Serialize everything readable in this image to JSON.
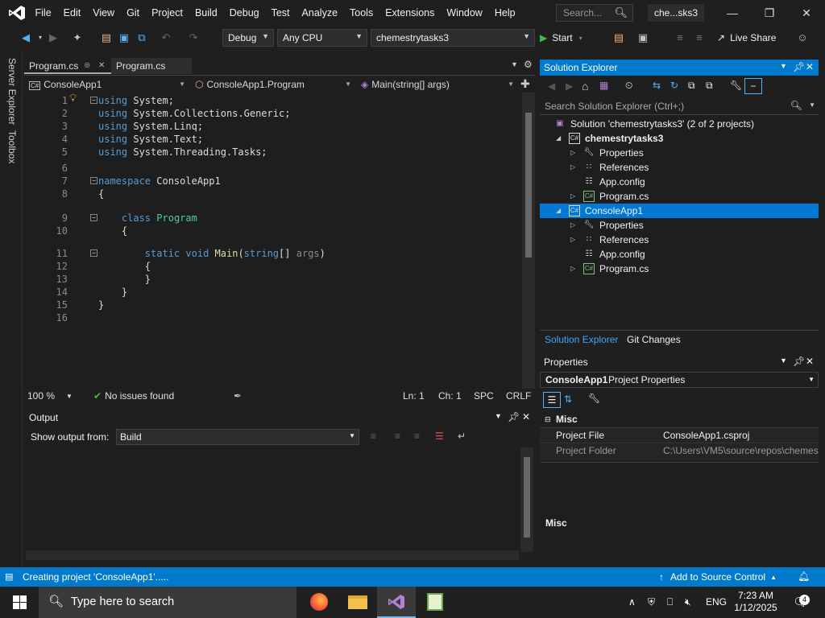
{
  "menubar": {
    "items": [
      "File",
      "Edit",
      "View",
      "Git",
      "Project",
      "Build",
      "Debug",
      "Test",
      "Analyze",
      "Tools",
      "Extensions",
      "Window",
      "Help"
    ],
    "search_placeholder": "Search...",
    "solution_title": "che...sks3"
  },
  "toolbar": {
    "config": "Debug",
    "platform": "Any CPU",
    "startup_project": "chemestrytasks3",
    "start_label": "Start",
    "live_share": "Live Share"
  },
  "left_strip": {
    "server_explorer": "Server Explorer",
    "toolbox": "Toolbox"
  },
  "editor": {
    "tabs": [
      "Program.cs",
      "Program.cs"
    ],
    "nav": {
      "project": "ConsoleApp1",
      "class": "ConsoleApp1.Program",
      "member": "Main(string[] args)"
    },
    "lines": [
      {
        "n": "1",
        "parts": [
          [
            "kw",
            "using"
          ],
          [
            "tx",
            " System;"
          ]
        ]
      },
      {
        "n": "2",
        "parts": [
          [
            "kw",
            "using"
          ],
          [
            "tx",
            " System.Collections.Generic;"
          ]
        ]
      },
      {
        "n": "3",
        "parts": [
          [
            "kw",
            "using"
          ],
          [
            "tx",
            " System.Linq;"
          ]
        ]
      },
      {
        "n": "4",
        "parts": [
          [
            "kw",
            "using"
          ],
          [
            "tx",
            " System.Text;"
          ]
        ]
      },
      {
        "n": "5",
        "parts": [
          [
            "kw",
            "using"
          ],
          [
            "tx",
            " System.Threading.Tasks;"
          ]
        ]
      },
      {
        "n": "6",
        "parts": []
      },
      {
        "n": "7",
        "parts": [
          [
            "kw",
            "namespace"
          ],
          [
            "tx",
            " ConsoleApp1"
          ]
        ]
      },
      {
        "n": "8",
        "parts": [
          [
            "tx",
            "{"
          ]
        ]
      },
      {
        "n": "9",
        "parts": [
          [
            "tx",
            "    "
          ],
          [
            "kw",
            "class"
          ],
          [
            "tx",
            " "
          ],
          [
            "ty",
            "Program"
          ]
        ]
      },
      {
        "n": "10",
        "parts": [
          [
            "tx",
            "    {"
          ]
        ]
      },
      {
        "n": "11",
        "parts": [
          [
            "tx",
            "        "
          ],
          [
            "kw",
            "static"
          ],
          [
            "tx",
            " "
          ],
          [
            "kw",
            "void"
          ],
          [
            "tx",
            " "
          ],
          [
            "fn",
            "Main"
          ],
          [
            "tx",
            "("
          ],
          [
            "kw",
            "string"
          ],
          [
            "tx",
            "[] "
          ],
          [
            "dim",
            "args"
          ],
          [
            "tx",
            ")"
          ]
        ]
      },
      {
        "n": "12",
        "parts": [
          [
            "tx",
            "        {"
          ]
        ]
      },
      {
        "n": "13",
        "parts": [
          [
            "tx",
            "        }"
          ]
        ]
      },
      {
        "n": "14",
        "parts": [
          [
            "tx",
            "    }"
          ]
        ]
      },
      {
        "n": "15",
        "parts": [
          [
            "tx",
            "}"
          ]
        ]
      },
      {
        "n": "16",
        "parts": []
      }
    ],
    "status": {
      "zoom": "100 %",
      "issues": "No issues found",
      "ln": "Ln: 1",
      "ch": "Ch: 1",
      "spc": "SPC",
      "crlf": "CRLF"
    }
  },
  "output": {
    "title": "Output",
    "show_from_label": "Show output from:",
    "source": "Build"
  },
  "solution_explorer": {
    "title": "Solution Explorer",
    "search_placeholder": "Search Solution Explorer (Ctrl+;)",
    "tree": [
      {
        "depth": 0,
        "label": "Solution 'chemestrytasks3' (2 of 2 projects)",
        "icon": "solution-icon",
        "chev": "",
        "bold": false,
        "selected": false
      },
      {
        "depth": 1,
        "label": "chemestrytasks3",
        "icon": "csharp-project-icon",
        "chev": "expanded",
        "bold": true,
        "selected": false
      },
      {
        "depth": 2,
        "label": "Properties",
        "icon": "wrench-icon",
        "chev": "collapsed",
        "bold": false,
        "selected": false
      },
      {
        "depth": 2,
        "label": "References",
        "icon": "references-icon",
        "chev": "collapsed",
        "bold": false,
        "selected": false
      },
      {
        "depth": 2,
        "label": "App.config",
        "icon": "config-file-icon",
        "chev": "",
        "bold": false,
        "selected": false
      },
      {
        "depth": 2,
        "label": "Program.cs",
        "icon": "csharp-file-icon",
        "chev": "collapsed",
        "bold": false,
        "selected": false
      },
      {
        "depth": 1,
        "label": "ConsoleApp1",
        "icon": "csharp-project-icon",
        "chev": "expanded",
        "bold": false,
        "selected": true
      },
      {
        "depth": 2,
        "label": "Properties",
        "icon": "wrench-icon",
        "chev": "collapsed",
        "bold": false,
        "selected": false
      },
      {
        "depth": 2,
        "label": "References",
        "icon": "references-icon",
        "chev": "collapsed",
        "bold": false,
        "selected": false
      },
      {
        "depth": 2,
        "label": "App.config",
        "icon": "config-file-icon",
        "chev": "",
        "bold": false,
        "selected": false
      },
      {
        "depth": 2,
        "label": "Program.cs",
        "icon": "csharp-file-icon",
        "chev": "collapsed",
        "bold": false,
        "selected": false
      }
    ],
    "tabs": [
      "Solution Explorer",
      "Git Changes"
    ]
  },
  "properties": {
    "title": "Properties",
    "object_name": "ConsoleApp1",
    "object_type": "Project Properties",
    "category": "Misc",
    "rows": [
      {
        "name": "Project File",
        "value": "ConsoleApp1.csproj"
      },
      {
        "name": "Project Folder",
        "value": "C:\\Users\\VM5\\source\\repos\\chemes"
      }
    ],
    "desc_title": "Misc"
  },
  "statusbar": {
    "message": "Creating project 'ConsoleApp1'.....",
    "source_control": "Add to Source Control",
    "notifications": "1"
  },
  "taskbar": {
    "search_placeholder": "Type here to search",
    "lang": "ENG",
    "time": "7:23 AM",
    "date": "1/12/2025",
    "notif_count": "4"
  },
  "colors": {
    "accent": "#007acc",
    "selection": "#0078d4",
    "keyword": "#569cd6",
    "type": "#4ec9b0",
    "method": "#dcdcaa",
    "start_green": "#3fb950"
  }
}
